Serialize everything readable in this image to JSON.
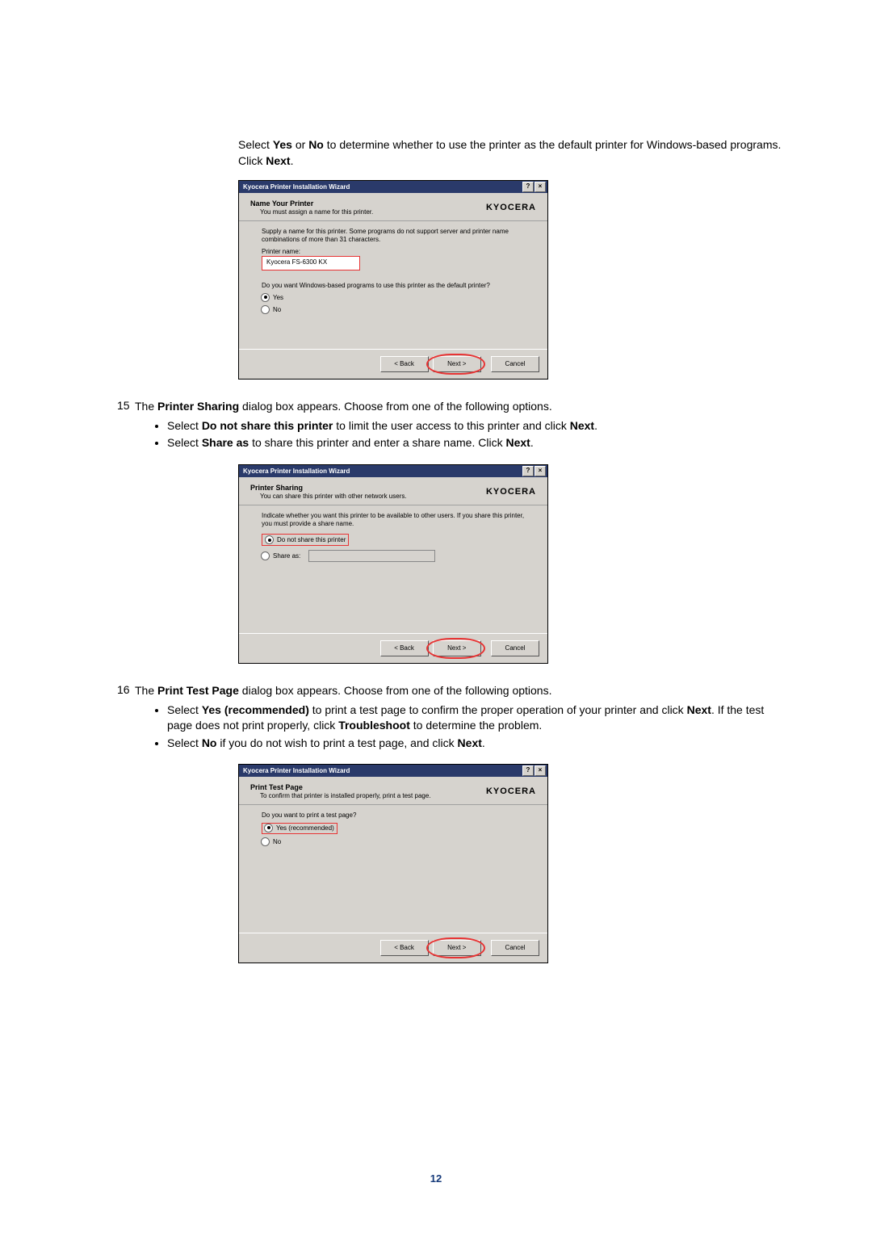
{
  "intro": {
    "pre": "Select ",
    "yes": "Yes",
    "or": " or ",
    "no": "No",
    "mid": " to determine whether to use the printer as the default printer for Windows-based programs. Click ",
    "next": "Next",
    "end": "."
  },
  "dlg1": {
    "titlebar": "Kyocera Printer Installation Wizard",
    "help": "?",
    "close": "×",
    "title": "Name Your Printer",
    "sub": "You must assign a name for this printer.",
    "brand": "KYOCERA",
    "notice": "Supply a name for this printer. Some programs do not support server and printer name combinations of more than 31 characters.",
    "label": "Printer name:",
    "value": "Kyocera FS-6300 KX",
    "question": "Do you want Windows-based programs to use this printer as the default printer?",
    "yes": "Yes",
    "no": "No",
    "back": "< Back",
    "next": "Next >",
    "cancel": "Cancel"
  },
  "step15": {
    "num": "15",
    "main_pre": "The ",
    "bold": "Printer Sharing",
    "main_post": " dialog box appears. Choose from one of the following options.",
    "b1_pre": "Select ",
    "b1_bold": "Do not share this printer",
    "b1_mid": " to limit the user access to this printer and click ",
    "b1_next": "Next",
    "b1_end": ".",
    "b2_pre": "Select ",
    "b2_bold": "Share as",
    "b2_mid": " to share this printer and enter a share name. Click ",
    "b2_next": "Next",
    "b2_end": "."
  },
  "dlg2": {
    "titlebar": "Kyocera Printer Installation Wizard",
    "help": "?",
    "close": "×",
    "title": "Printer Sharing",
    "sub": "You can share this printer with other network users.",
    "brand": "KYOCERA",
    "notice": "Indicate whether you want this printer to be available to other users. If you share this printer, you must provide a share name.",
    "opt1": "Do not share this printer",
    "opt2": "Share as:",
    "back": "< Back",
    "next": "Next >",
    "cancel": "Cancel"
  },
  "step16": {
    "num": "16",
    "main_pre": "The ",
    "bold": "Print Test Page",
    "main_post": " dialog box appears. Choose from one of the following options.",
    "b1_pre": "Select ",
    "b1_bold": "Yes (recommended)",
    "b1_mid": " to print a test page to confirm the proper operation of your printer and click ",
    "b1_next": "Next",
    "b1_mid2": ". If the test page does not print properly, click ",
    "b1_tr": "Troubleshoot",
    "b1_end": " to determine the problem.",
    "b2_pre": "Select ",
    "b2_bold": "No",
    "b2_mid": " if you do not wish to print a test page, and click ",
    "b2_next": "Next",
    "b2_end": "."
  },
  "dlg3": {
    "titlebar": "Kyocera Printer Installation Wizard",
    "help": "?",
    "close": "×",
    "title": "Print Test Page",
    "sub": "To confirm that printer is installed properly, print a test page.",
    "brand": "KYOCERA",
    "question": "Do you want to print a test page?",
    "yes": "Yes (recommended)",
    "no": "No",
    "back": "< Back",
    "next": "Next >",
    "cancel": "Cancel"
  },
  "page_number": "12"
}
